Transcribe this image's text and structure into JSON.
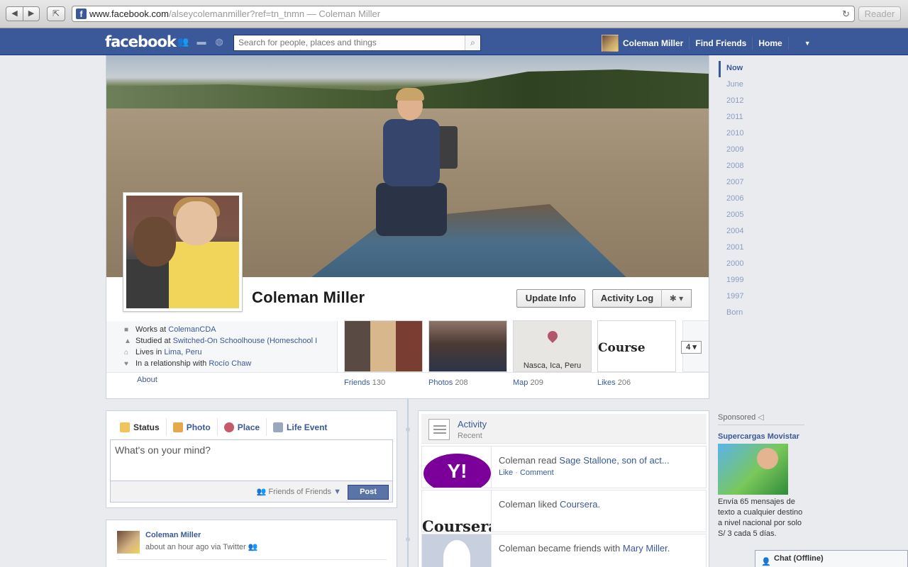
{
  "browser": {
    "url_host": "www.facebook.com",
    "url_path": "/alseycolemanmiller?ref=tn_tnmn",
    "url_title_suffix": " — Coleman Miller",
    "reader_label": "Reader",
    "favicon_letter": "f"
  },
  "topbar": {
    "logo": "facebook",
    "search_placeholder": "Search for people, places and things",
    "user_name": "Coleman Miller",
    "find_friends": "Find Friends",
    "home": "Home"
  },
  "profile": {
    "name": "Coleman Miller",
    "update_info": "Update Info",
    "activity_log": "Activity Log",
    "works_prefix": "Works at ",
    "works_link": "ColemanCDA",
    "studied_prefix": "Studied at ",
    "studied_link": "Switched-On Schoolhouse (Homeschool I",
    "lives_prefix": "Lives in ",
    "lives_link": "Lima, Peru",
    "rel_prefix": "In a relationship with ",
    "rel_link": "Rocío Chaw",
    "about": "About"
  },
  "tiles": {
    "friends_label": "Friends",
    "friends_count": "130",
    "photos_label": "Photos",
    "photos_count": "208",
    "map_label": "Map",
    "map_count": "209",
    "map_caption": "Nasca, Ica, Peru",
    "likes_label": "Likes",
    "likes_count": "206",
    "course_text": "Course",
    "more_value": "4"
  },
  "timeline_years": [
    "Now",
    "June",
    "2012",
    "2011",
    "2010",
    "2009",
    "2008",
    "2007",
    "2006",
    "2005",
    "2004",
    "2001",
    "2000",
    "1999",
    "1997",
    "Born"
  ],
  "composer": {
    "tab_status": "Status",
    "tab_photo": "Photo",
    "tab_place": "Place",
    "tab_life_event": "Life Event",
    "placeholder": "What's on your mind?",
    "audience": "Friends of Friends",
    "post": "Post"
  },
  "story": {
    "name": "Coleman Miller",
    "meta": "about an hour ago via Twitter"
  },
  "activity": {
    "title": "Activity",
    "subtitle": "Recent",
    "row1_prefix": "Coleman read ",
    "row1_link": "Sage Stallone, son of act...",
    "row1_like": "Like",
    "row1_sep": " · ",
    "row1_comment": "Comment",
    "row1_thumb": "Y!",
    "row2_prefix": "Coleman liked ",
    "row2_link": "Coursera",
    "row2_suffix": ".",
    "row2_thumb": "Coursera",
    "row3_prefix": "Coleman became friends with ",
    "row3_link": "Mary Miller",
    "row3_suffix": "."
  },
  "sponsored": {
    "header": "Sponsored",
    "title": "Supercargas Movistar",
    "desc": "Envía 65 mensajes de texto a cualquier destino a nivel nacional por solo S/ 3 cada 5 días."
  },
  "chat": {
    "label": "Chat (Offline)"
  },
  "colors": {
    "facebook_blue": "#3b5998",
    "link": "#3b5998",
    "post_button": "#5b74a8"
  }
}
